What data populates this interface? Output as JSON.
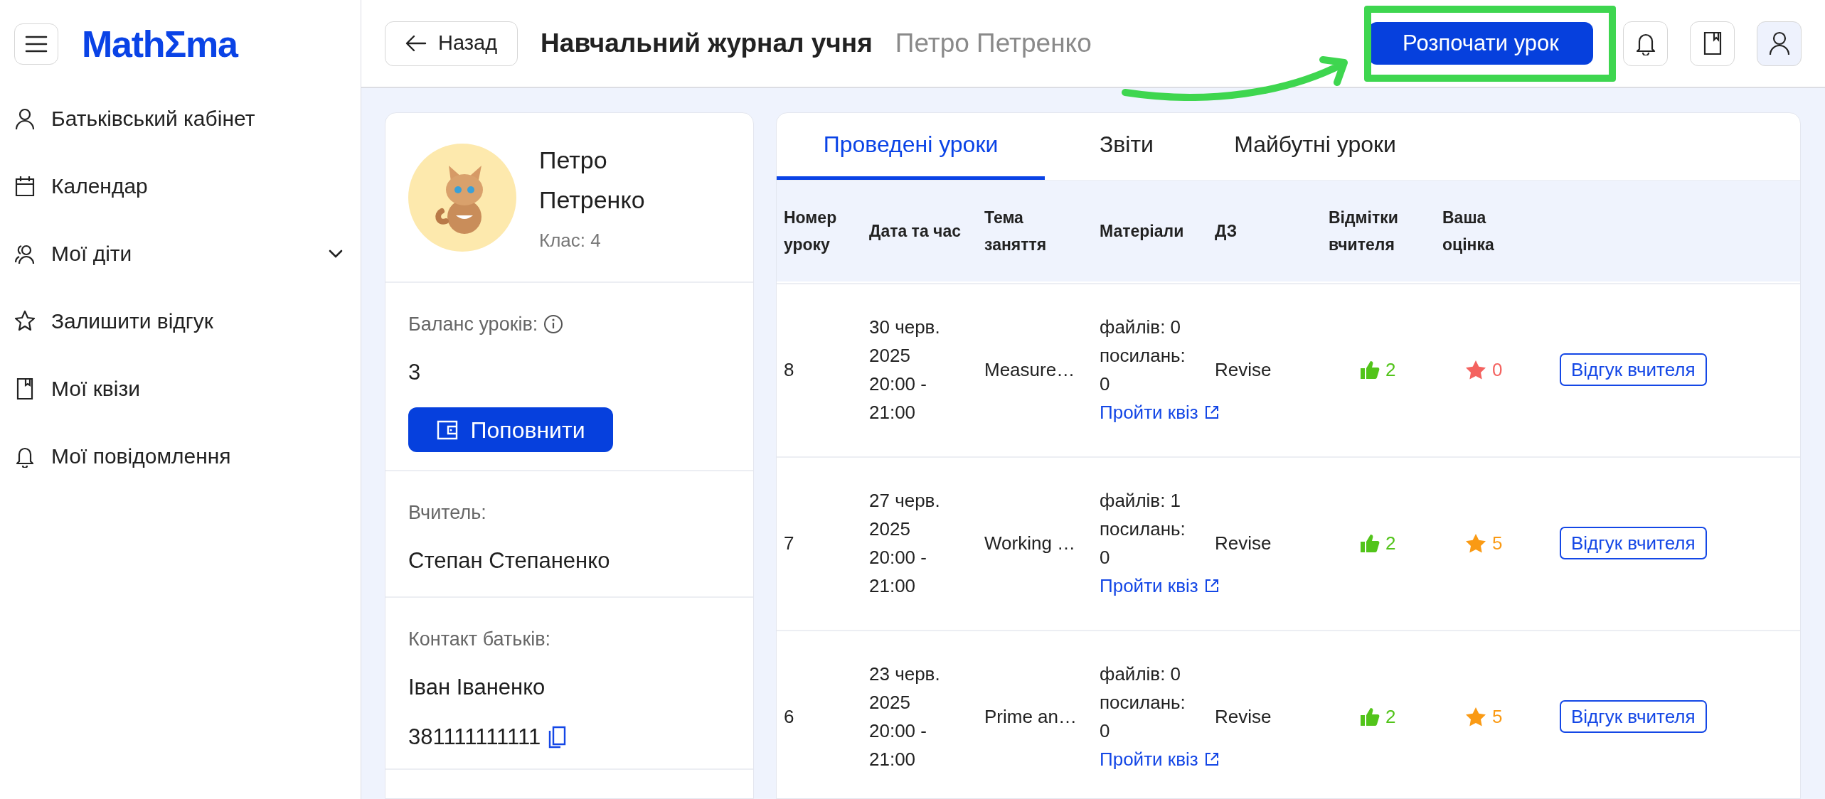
{
  "app": {
    "logo": "MathΣma"
  },
  "sidebar": {
    "items": [
      {
        "kind": "person",
        "label": "Батьківський кабінет"
      },
      {
        "kind": "calendar",
        "label": "Календар"
      },
      {
        "kind": "people",
        "label": "Мої діти",
        "expanded": false
      },
      {
        "kind": "star",
        "label": "Залишити відгук"
      },
      {
        "kind": "book",
        "label": "Мої квізи"
      },
      {
        "kind": "bell",
        "label": "Мої повідомлення"
      }
    ]
  },
  "header": {
    "back_button": "Назад",
    "title": "Навчальний журнал учня",
    "student": "Петро Петренко",
    "start_button": "Розпочати урок"
  },
  "profile": {
    "name": "Петро Петренко",
    "class": "Клас: 4",
    "balance_label": "Баланс уроків:",
    "balance": "3",
    "topup_button": "Поповнити",
    "teacher_label": "Вчитель:",
    "teacher": "Степан Степаненко",
    "parent_label": "Контакт батьків:",
    "parent": "Іван Іваненко",
    "phone": "381111111111"
  },
  "tabs": [
    {
      "label": "Проведені уроки",
      "selected": true
    },
    {
      "label": "Звіти",
      "selected": false
    },
    {
      "label": "Майбутні уроки",
      "selected": false
    }
  ],
  "table": {
    "columns": [
      "Номер уроку",
      "Дата та час",
      "Тема заняття",
      "Матеріали",
      "ДЗ",
      "Відмітки вчителя",
      "Ваша оцінка"
    ],
    "rows": [
      {
        "number": "8",
        "date": "30 черв. 2025",
        "time": "20:00 - 21:00",
        "topic": "Measure…",
        "files": "файлів: 0",
        "links": "посилань: 0",
        "quiz_link": "Пройти квіз",
        "homework": "Revise",
        "likes": "2",
        "rating": {
          "value": "0",
          "color": "#f4625f"
        },
        "feedback_button": "Відгук вчителя"
      },
      {
        "number": "7",
        "date": "27 черв. 2025",
        "time": "20:00 - 21:00",
        "topic": "Working …",
        "files": "файлів: 1",
        "links": "посилань: 0",
        "quiz_link": "Пройти квіз",
        "homework": "Revise",
        "likes": "2",
        "rating": {
          "value": "5",
          "color": "#fa9a14"
        },
        "feedback_button": "Відгук вчителя"
      },
      {
        "number": "6",
        "date": "23 черв. 2025",
        "time": "20:00 - 21:00",
        "topic": "Prime an…",
        "files": "файлів: 0",
        "links": "посилань: 0",
        "quiz_link": "Пройти квіз",
        "homework": "Revise",
        "likes": "2",
        "rating": {
          "value": "5",
          "color": "#fa9a14"
        },
        "feedback_button": "Відгук вчителя"
      }
    ]
  }
}
